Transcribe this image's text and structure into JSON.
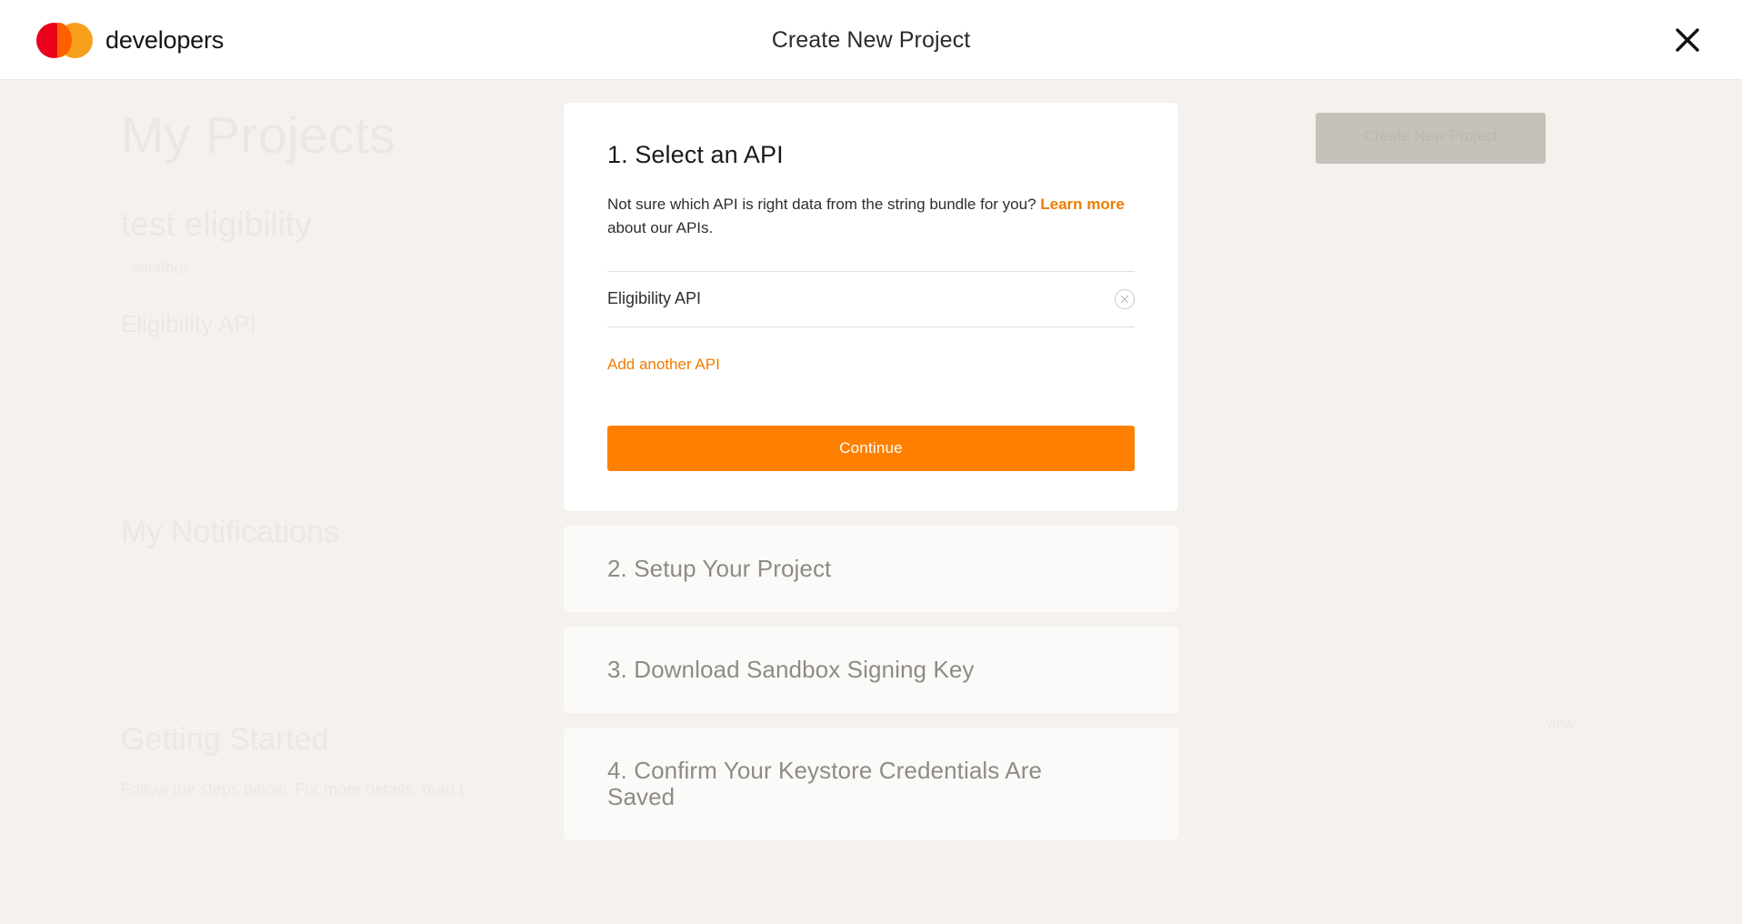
{
  "header": {
    "brand": "developers",
    "logo_icon": "mastercard-logo",
    "title": "Create New Project",
    "close_icon": "close-icon"
  },
  "background": {
    "page_title": "My Projects",
    "project_name": "test eligibility",
    "project_sub": "sandbox",
    "project_api": "Eligibility API",
    "notifications_title": "My Notifications",
    "getting_started_title": "Getting Started",
    "getting_started_sub": "Follow the steps below. For more details, read t",
    "cta_label": "Create New Project",
    "right_small": "view"
  },
  "modal": {
    "active_step": {
      "heading": "1. Select an API",
      "description_before": "Not sure which API is right data from the string bundle for you? ",
      "link_label": "Learn more",
      "description_after": " about our APIs.",
      "selected_api": "Eligibility API",
      "remove_icon": "remove-circle-icon",
      "add_another_label": "Add another API",
      "continue_label": "Continue"
    },
    "collapsed_steps": [
      {
        "title": "2. Setup Your Project"
      },
      {
        "title": "3. Download Sandbox Signing Key"
      },
      {
        "title": "4. Confirm Your Keystore Credentials Are Saved"
      }
    ]
  },
  "colors": {
    "accent_orange": "#ff8000",
    "link_orange": "#f07c00",
    "page_background": "#f5f2ed",
    "card_background": "#ffffff",
    "collapsed_background": "#fbfaf8",
    "logo_red": "#eb001b",
    "logo_yellow": "#f79e1b",
    "logo_overlap": "#ff5f00"
  }
}
